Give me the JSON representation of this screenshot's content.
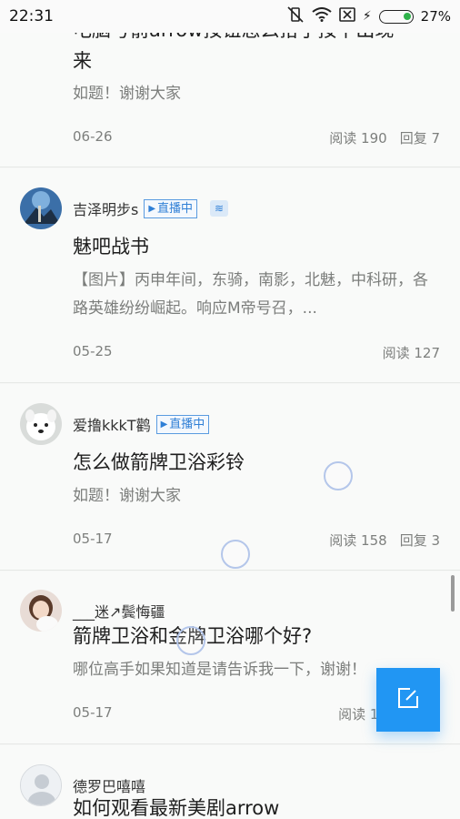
{
  "status_bar": {
    "time": "22:31",
    "battery_percent": "27%",
    "battery_level": 0.27
  },
  "posts": [
    {
      "title_partial": "电脑号箭arrow按钮怎么拾子按下出现",
      "title_line2": "来",
      "excerpt": "如题！谢谢大家",
      "date": "06-26",
      "reads": "阅读 190",
      "replies": "回复 7"
    },
    {
      "author": "吉泽明步s",
      "live_label": "直播中",
      "level_icon": "wave-icon",
      "title": "魅吧战书",
      "excerpt": "【图片】丙申年间，东骑，南影，北魅，中科研，各路英雄纷纷崛起。响应M帝号召，...",
      "date": "05-25",
      "reads": "阅读 127"
    },
    {
      "author": "爱撸kkkT鹳",
      "live_label": "直播中",
      "title": "怎么做箭牌卫浴彩铃",
      "excerpt": "如题！谢谢大家",
      "date": "05-17",
      "reads": "阅读 158",
      "replies": "回复 3"
    },
    {
      "author": "___迷↗鬓悔疆",
      "title": "箭牌卫浴和金牌卫浴哪个好?",
      "excerpt": "哪位高手如果知道是请告诉我一下，谢谢！",
      "date": "05-17",
      "reads": "阅读 14"
    },
    {
      "author": "德罗巴嘻嘻",
      "title": "如何观看最新美剧arrow"
    }
  ],
  "fab": {
    "icon": "compose-icon"
  },
  "colors": {
    "accent": "#2196f3",
    "live_badge": "#2f7fd6",
    "battery_fill": "#2fb24b"
  }
}
